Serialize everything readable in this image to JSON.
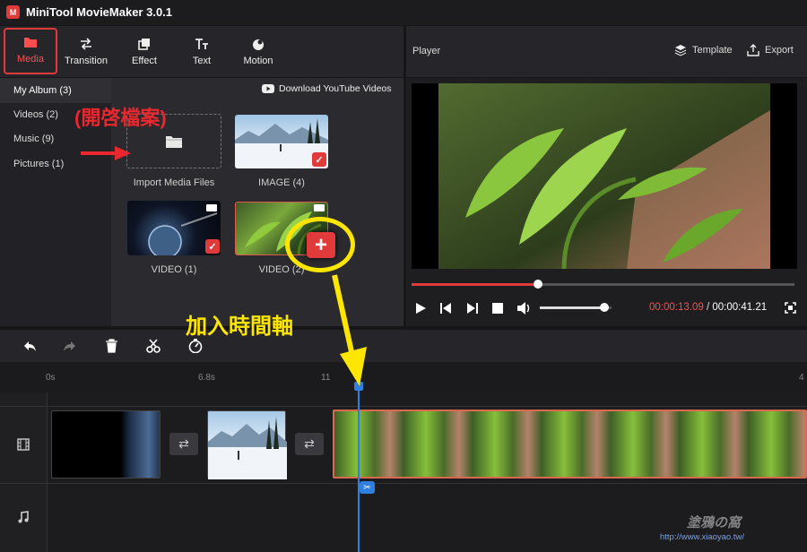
{
  "app": {
    "logo": "M",
    "title": "MiniTool MovieMaker 3.0.1"
  },
  "toolbar": {
    "media": "Media",
    "transition": "Transition",
    "effect": "Effect",
    "text": "Text",
    "motion": "Motion"
  },
  "player": {
    "title": "Player",
    "template": "Template",
    "export": "Export",
    "current_time": "00:00:13.09",
    "separator": " / ",
    "total_time": "00:00:41.21",
    "progress": 0.33,
    "volume": 0.9
  },
  "sidebar": {
    "items": [
      {
        "label": "My Album (3)"
      },
      {
        "label": "Videos (2)"
      },
      {
        "label": "Music (9)"
      },
      {
        "label": "Pictures (1)"
      }
    ]
  },
  "media": {
    "download_label": "Download YouTube Videos",
    "import_label": "Import Media Files",
    "items": [
      {
        "label": "IMAGE (4)"
      },
      {
        "label": "VIDEO (1)"
      },
      {
        "label": "VIDEO (2)"
      }
    ]
  },
  "timeline": {
    "ticks": [
      "0s",
      "6.8s",
      "11",
      "4"
    ]
  },
  "annotations": {
    "open_file": "(開啓檔案)",
    "add_timeline": "加入時間軸"
  },
  "watermark": {
    "line1": "塗鴉の窩",
    "line2": "http://www.xiaoyao.tw/"
  },
  "colors": {
    "accent": "#e03a3a",
    "playhead": "#2f7fe0",
    "annotation": "#ffe600"
  }
}
